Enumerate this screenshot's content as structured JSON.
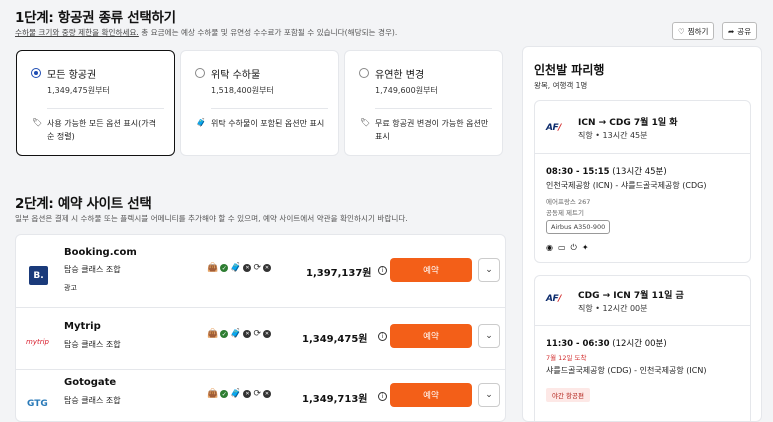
{
  "step1": {
    "title": "1단계: 항공권 종류 선택하기",
    "link_text": "수하물 크기와 중량 제한을 확인하세요.",
    "note": " 총 요금에는 예상 수하물 및 유연성 수수료가 포함될 수 있습니다(해당되는 경우).",
    "options": [
      {
        "name": "모든 항공권",
        "price": "1,349,475원부터",
        "desc": "사용 가능한 모든 옵션 표시(가격순 정렬)",
        "selected": true,
        "icon": "tag-icon"
      },
      {
        "name": "위탁 수하물",
        "price": "1,518,400원부터",
        "desc": "위탁 수하물이 포함된 옵션만 표시",
        "selected": false,
        "icon": "suitcase-icon"
      },
      {
        "name": "유연한 변경",
        "price": "1,749,600원부터",
        "desc": "무료 항공권 변경이 가능한 옵션만 표시",
        "selected": false,
        "icon": "tag-icon"
      }
    ]
  },
  "actions": {
    "share_like": "찜하기",
    "share": "공유"
  },
  "step2": {
    "title": "2단계: 예약 사이트 선택",
    "note": "일부 옵션은 결제 시 수하물 또는 플렉시블 어메니티를 추가해야 할 수 있으며, 예약 사이트에서 약관을 확인하시기 바랍니다."
  },
  "providers": [
    {
      "name": "Booking.com",
      "cabin": "탑승 클래스 조합",
      "ad": "광고",
      "price": "1,397,137원",
      "book": "예약",
      "logo": "B.",
      "logo_bg": "#1a3a7a"
    },
    {
      "name": "Mytrip",
      "cabin": "탑승 클래스 조합",
      "ad": "",
      "price": "1,349,475원",
      "book": "예약",
      "logo": "mytrip",
      "logo_bg": "#ffffff"
    },
    {
      "name": "Gotogate",
      "cabin": "탑승 클래스 조합",
      "ad": "",
      "price": "1,349,713원",
      "book": "예약",
      "logo": "GTG",
      "logo_bg": "#ffffff"
    }
  ],
  "trip": {
    "title": "인천발 파리행",
    "subtitle": "왕복, 여행객 1명",
    "airline_logo": "AF",
    "outbound": {
      "route": "ICN → CDG  7월 1일 화",
      "summary": "직항 • 13시간 45분",
      "times": "08:30 - 15:15",
      "duration": " (13시간 45분)",
      "airports": "인천국제공항 (ICN) - 샤를드골국제공항 (CDG)",
      "flight": "에어프랑스 267",
      "operator": "공동제 제트기",
      "aircraft": "Airbus A350-900",
      "amenities": [
        "wifi-icon",
        "screen-icon",
        "power-icon",
        "meal-icon"
      ]
    },
    "inbound": {
      "route": "CDG → ICN  7월 11일 금",
      "summary": "직항 • 12시간 00분",
      "times": "11:30 - 06:30",
      "duration": " (12시간 00분)",
      "arrival_note": "7월 12일 도착",
      "airports": "샤를드골국제공항 (CDG) - 인천국제공항 (ICN)",
      "badge": "야간 항공편"
    }
  }
}
